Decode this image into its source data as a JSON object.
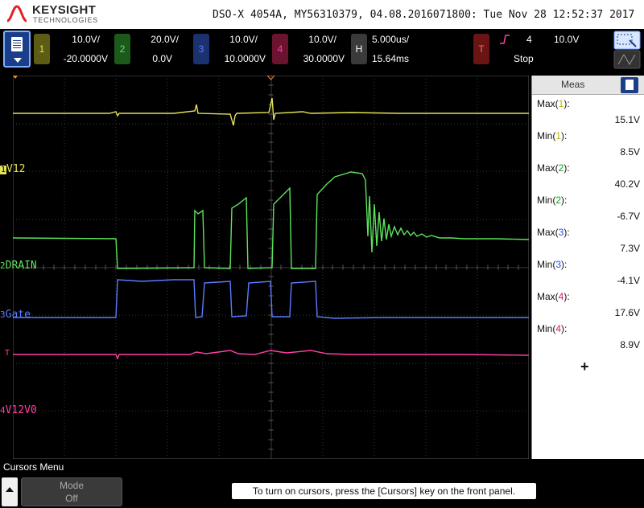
{
  "header": {
    "brand": "KEYSIGHT",
    "brand_sub": "TECHNOLOGIES",
    "info": "DSO-X 4054A, MY56310379, 04.08.2016071800: Tue Nov 28 12:52:37 2017"
  },
  "channels": [
    {
      "num": "1",
      "scale": "10.0V/",
      "offset": "-20.0000V",
      "color": "#e3e35a",
      "bg": "#5c5c14",
      "label": "V12"
    },
    {
      "num": "2",
      "scale": "20.0V/",
      "offset": "0.0V",
      "color": "#5ee35e",
      "bg": "#1b5a1b",
      "label": "DRAIN"
    },
    {
      "num": "3",
      "scale": "10.0V/",
      "offset": "10.0000V",
      "color": "#5a7dff",
      "bg": "#1c3170",
      "label": "Gate"
    },
    {
      "num": "4",
      "scale": "10.0V/",
      "offset": "30.0000V",
      "color": "#ff3fa6",
      "bg": "#6a1430",
      "label": "V12V0"
    }
  ],
  "horizontal": {
    "key": "H",
    "timebase": "5.000us/",
    "delay": "15.64ms"
  },
  "trigger": {
    "key": "T",
    "slope_icon": "rising-edge-icon",
    "source": "4",
    "level": "10.0V",
    "status": "Stop"
  },
  "meas": {
    "title": "Meas",
    "items": [
      {
        "label": "Max(",
        "ch": "1",
        "suffix": "):",
        "value": "15.1V",
        "color": "#b8b800"
      },
      {
        "label": "Min(",
        "ch": "1",
        "suffix": "):",
        "value": "8.5V",
        "color": "#b8b800"
      },
      {
        "label": "Max(",
        "ch": "2",
        "suffix": "):",
        "value": "40.2V",
        "color": "#10a010"
      },
      {
        "label": "Min(",
        "ch": "2",
        "suffix": "):",
        "value": "-6.7V",
        "color": "#10a010"
      },
      {
        "label": "Max(",
        "ch": "3",
        "suffix": "):",
        "value": "7.3V",
        "color": "#2a4ee0"
      },
      {
        "label": "Min(",
        "ch": "3",
        "suffix": "):",
        "value": "-4.1V",
        "color": "#2a4ee0"
      },
      {
        "label": "Max(",
        "ch": "4",
        "suffix": "):",
        "value": "17.6V",
        "color": "#e0106e"
      },
      {
        "label": "Min(",
        "ch": "4",
        "suffix": "):",
        "value": "8.9V",
        "color": "#e0106e"
      }
    ],
    "add_label": "+"
  },
  "bottom": {
    "menu_title": "Cursors Menu",
    "mode_label": "Mode",
    "mode_value": "Off",
    "hint": "To turn on cursors, press the [Cursors] key on the front panel."
  },
  "markers": {
    "trigger": "T"
  }
}
